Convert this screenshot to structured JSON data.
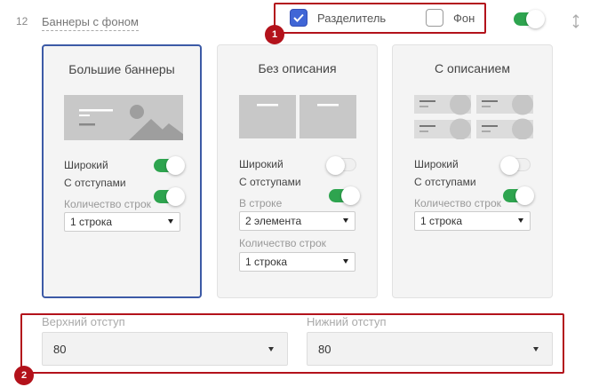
{
  "header": {
    "row_number": "12",
    "section_title": "Баннеры с фоном",
    "checkbox_separator_label": "Разделитель",
    "checkbox_separator_checked": true,
    "checkbox_background_label": "Фон",
    "checkbox_background_checked": false,
    "visibility_toggle_on": true
  },
  "badges": {
    "first": "1",
    "second": "2"
  },
  "cards": [
    {
      "title": "Большие баннеры",
      "selected": true,
      "wide_label": "Широкий",
      "wide_on": true,
      "padding_label": "С отступами",
      "padding_on": true,
      "rows_label": "Количество строк",
      "rows_value": "1 строка"
    },
    {
      "title": "Без описания",
      "selected": false,
      "wide_label": "Широкий",
      "wide_on": false,
      "padding_label": "С отступами",
      "padding_on": true,
      "per_row_label": "В строке",
      "per_row_value": "2 элемента",
      "rows_label": "Количество строк",
      "rows_value": "1 строка"
    },
    {
      "title": "С описанием",
      "selected": false,
      "wide_label": "Широкий",
      "wide_on": false,
      "padding_label": "С отступами",
      "padding_on": true,
      "rows_label": "Количество строк",
      "rows_value": "1 строка"
    }
  ],
  "spacing": {
    "top_label": "Верхний отступ",
    "top_value": "80",
    "bottom_label": "Нижний отступ",
    "bottom_value": "80"
  },
  "colors": {
    "accent_red": "#b3121b",
    "toggle_green": "#2ea44f",
    "checkbox_blue": "#4066d6",
    "selected_border": "#3c5aa6"
  }
}
